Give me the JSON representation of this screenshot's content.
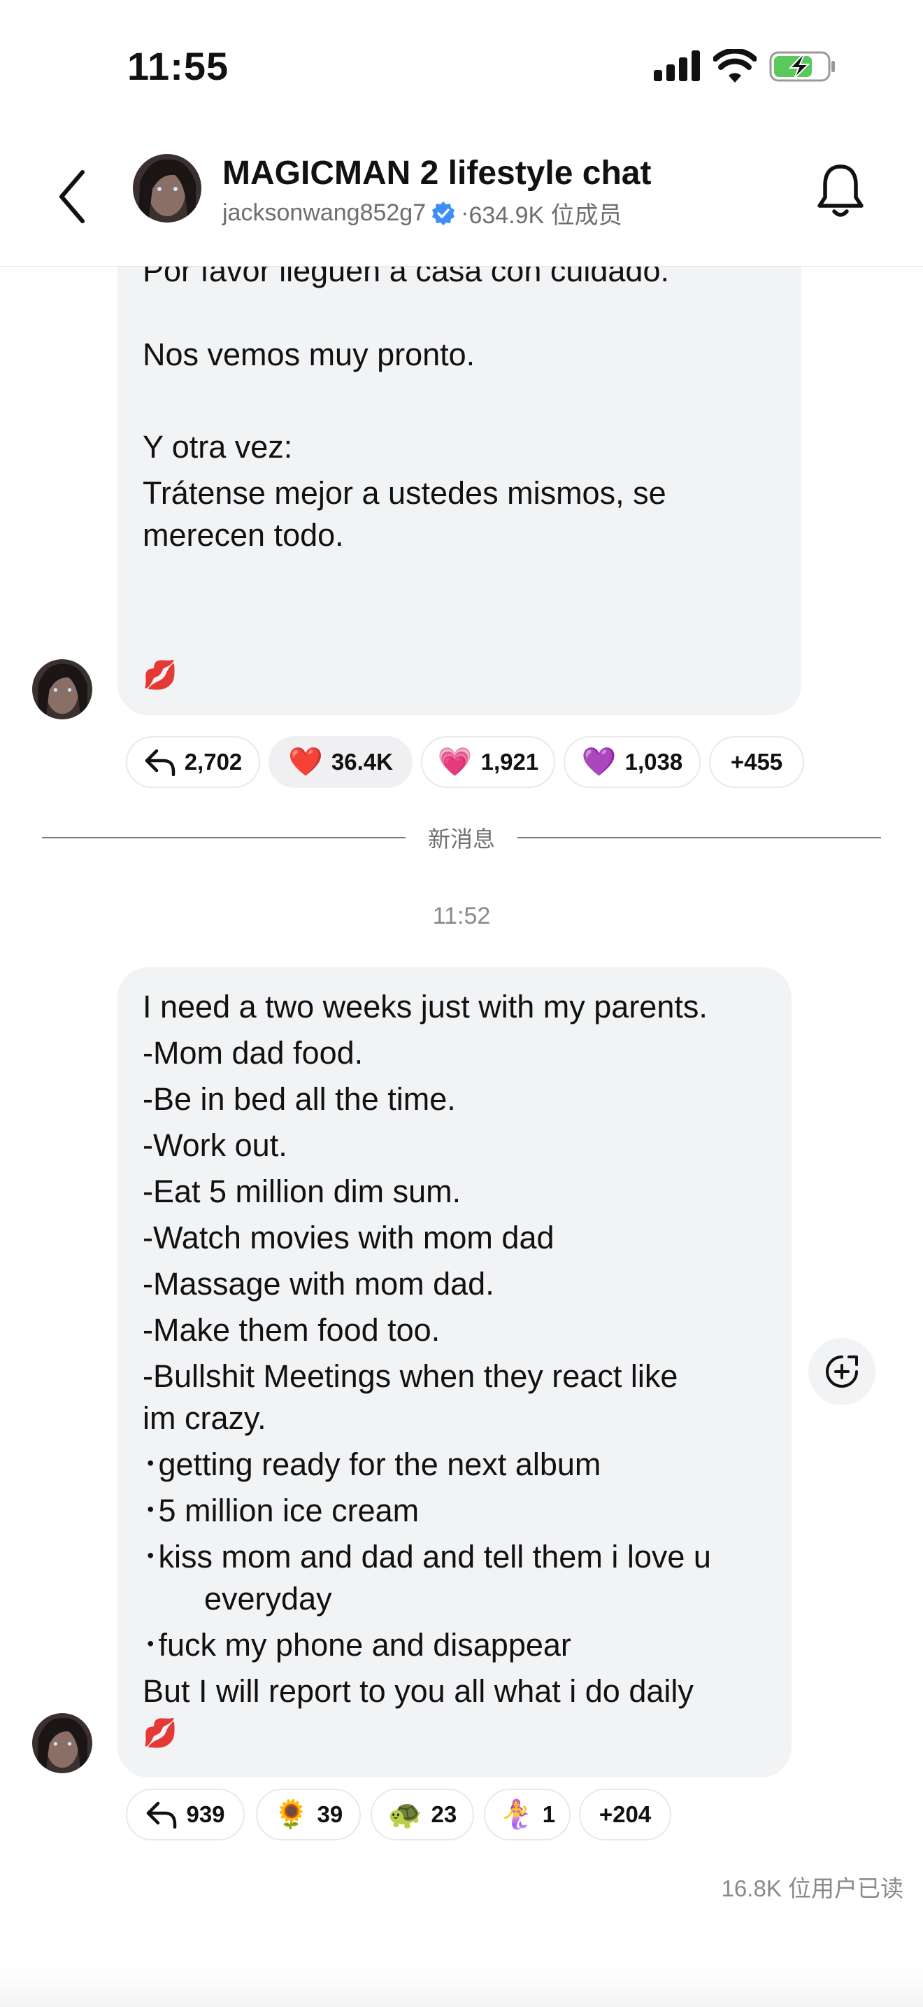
{
  "status_bar": {
    "time": "11:55"
  },
  "header": {
    "title": "MAGICMAN 2 lifestyle chat",
    "handle": "jacksonwang852g7",
    "separator": "·",
    "members": "634.9K 位成员"
  },
  "message1": {
    "lines": [
      "Por favor lleguen a casa con cuidado.",
      "Nos vemos muy pronto.",
      "Y otra vez:",
      "Trátense mejor a ustedes mismos, se",
      "merecen todo."
    ],
    "emoji": "💋",
    "reactions": [
      {
        "type": "reply-icon",
        "count": "2,702"
      },
      {
        "emoji": "❤️",
        "count": "36.4K",
        "selected": true
      },
      {
        "emoji": "💗",
        "count": "1,921"
      },
      {
        "emoji": "💜",
        "count": "1,038"
      },
      {
        "label": "+455"
      }
    ]
  },
  "divider": {
    "label": "新消息"
  },
  "timestamp": "11:52",
  "message2": {
    "lines": [
      "I need a two weeks just with my parents.",
      "-Mom dad food.",
      "-Be in bed all the time.",
      "-Work out.",
      "-Eat 5 million dim sum.",
      "-Watch movies with mom dad",
      "-Massage with mom dad.",
      "-Make them food too.",
      "-Bullshit Meetings when they react like",
      "im crazy.",
      "･getting ready for the next album",
      "･5 million ice cream",
      "･kiss mom and dad and tell them i love u",
      "everyday",
      "･fuck my phone and disappear",
      "But I will report to you all what i do daily"
    ],
    "emoji": "💋",
    "reactions": [
      {
        "type": "reply-icon",
        "count": "939"
      },
      {
        "emoji": "🌻",
        "count": "39"
      },
      {
        "emoji": "🐢",
        "count": "23"
      },
      {
        "emoji": "🧜‍♀️",
        "count": "1"
      },
      {
        "label": "+204"
      }
    ]
  },
  "read_receipt": "16.8K 位用户已读",
  "colors": {
    "bubble": "#f2f3f5",
    "verified": "#3d8ef6",
    "battery_fill": "#5ac85a"
  }
}
